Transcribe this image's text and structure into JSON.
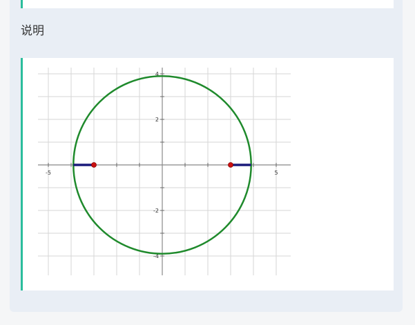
{
  "section": {
    "label": "说明"
  },
  "graph": {
    "x_range": [
      -5.5,
      5.5
    ],
    "y_range": [
      -4.6,
      4.6
    ],
    "x_ticks": [
      "-5",
      "5"
    ],
    "y_ticks": [
      "4",
      "2",
      "-2",
      "-4"
    ],
    "circle": {
      "center": [
        0,
        0
      ],
      "radius": 3.9,
      "color": "#1f8a2c"
    },
    "segments": [
      {
        "from": [
          -3.9,
          0
        ],
        "to": [
          -3.0,
          0
        ],
        "color": "#1a1a7a"
      },
      {
        "from": [
          3.0,
          0
        ],
        "to": [
          3.9,
          0
        ],
        "color": "#1a1a7a"
      }
    ],
    "points": [
      {
        "x": -3.0,
        "y": 0,
        "color": "#cc1111"
      },
      {
        "x": 3.0,
        "y": 0,
        "color": "#cc1111"
      }
    ]
  }
}
